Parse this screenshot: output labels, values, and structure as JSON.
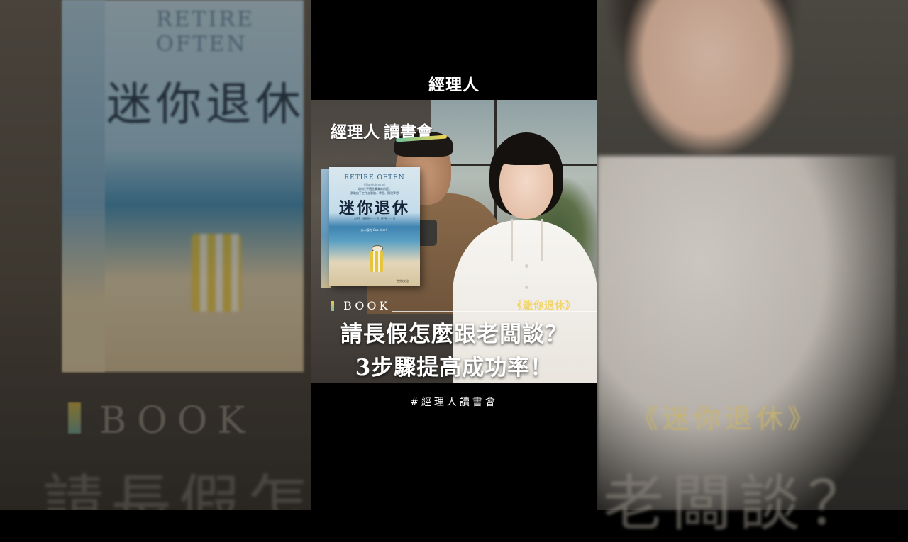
{
  "backdrop": {
    "left_book_title": "迷你退休",
    "left_book_en": "RETIRE OFTEN",
    "left_band": "BOOK",
    "left_headline_fragment": "請長假怎",
    "right_book_name": "《迷你退休》",
    "right_headline_fragment": "老闆談？"
  },
  "header": {
    "brand": "經理人"
  },
  "thumbnail": {
    "logo": "經理人",
    "club": "讀書會",
    "book_cover": {
      "en_title": "RETIRE OFTEN",
      "en_author": "Jillian Johnsrud",
      "tagline_1": "如何在不犧牲事業的前提，",
      "tagline_2": "勇敢放下工作去冒險、學習、實現夢想",
      "cn_title": "迷你退休",
      "authors": "吉莉安・強思若德 —— 著　林宇蔵 —— 譯",
      "gap_year": "大人版的 Gap Year！",
      "publisher": "悅知文化"
    },
    "section_label": "BOOK",
    "book_name": "《迷你退休》",
    "headline_line1": "請長假怎麼跟老闆談？",
    "headline_line2": "3步驟提高成功率！"
  },
  "caption": "#經理人讀書會",
  "colors": {
    "accent_gold": "#f2d56a",
    "accent_green": "#3fb37f",
    "background": "#000000"
  }
}
